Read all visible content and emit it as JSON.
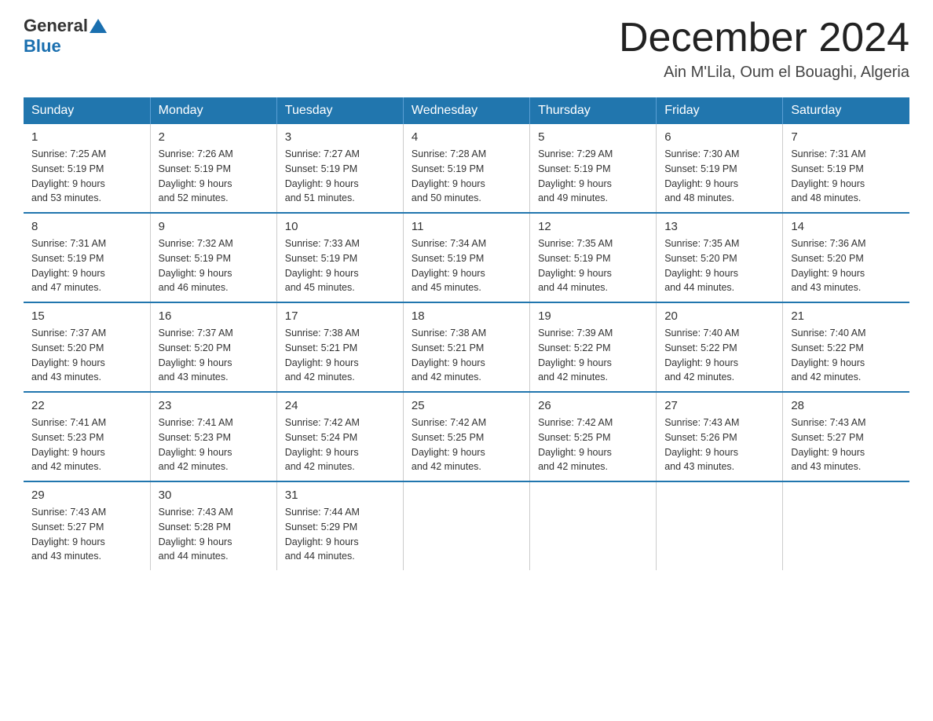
{
  "header": {
    "logo_general": "General",
    "logo_blue": "Blue",
    "month_title": "December 2024",
    "location": "Ain M'Lila, Oum el Bouaghi, Algeria"
  },
  "weekdays": [
    "Sunday",
    "Monday",
    "Tuesday",
    "Wednesday",
    "Thursday",
    "Friday",
    "Saturday"
  ],
  "weeks": [
    [
      {
        "day": "1",
        "sunrise": "7:25 AM",
        "sunset": "5:19 PM",
        "daylight": "9 hours and 53 minutes."
      },
      {
        "day": "2",
        "sunrise": "7:26 AM",
        "sunset": "5:19 PM",
        "daylight": "9 hours and 52 minutes."
      },
      {
        "day": "3",
        "sunrise": "7:27 AM",
        "sunset": "5:19 PM",
        "daylight": "9 hours and 51 minutes."
      },
      {
        "day": "4",
        "sunrise": "7:28 AM",
        "sunset": "5:19 PM",
        "daylight": "9 hours and 50 minutes."
      },
      {
        "day": "5",
        "sunrise": "7:29 AM",
        "sunset": "5:19 PM",
        "daylight": "9 hours and 49 minutes."
      },
      {
        "day": "6",
        "sunrise": "7:30 AM",
        "sunset": "5:19 PM",
        "daylight": "9 hours and 48 minutes."
      },
      {
        "day": "7",
        "sunrise": "7:31 AM",
        "sunset": "5:19 PM",
        "daylight": "9 hours and 48 minutes."
      }
    ],
    [
      {
        "day": "8",
        "sunrise": "7:31 AM",
        "sunset": "5:19 PM",
        "daylight": "9 hours and 47 minutes."
      },
      {
        "day": "9",
        "sunrise": "7:32 AM",
        "sunset": "5:19 PM",
        "daylight": "9 hours and 46 minutes."
      },
      {
        "day": "10",
        "sunrise": "7:33 AM",
        "sunset": "5:19 PM",
        "daylight": "9 hours and 45 minutes."
      },
      {
        "day": "11",
        "sunrise": "7:34 AM",
        "sunset": "5:19 PM",
        "daylight": "9 hours and 45 minutes."
      },
      {
        "day": "12",
        "sunrise": "7:35 AM",
        "sunset": "5:19 PM",
        "daylight": "9 hours and 44 minutes."
      },
      {
        "day": "13",
        "sunrise": "7:35 AM",
        "sunset": "5:20 PM",
        "daylight": "9 hours and 44 minutes."
      },
      {
        "day": "14",
        "sunrise": "7:36 AM",
        "sunset": "5:20 PM",
        "daylight": "9 hours and 43 minutes."
      }
    ],
    [
      {
        "day": "15",
        "sunrise": "7:37 AM",
        "sunset": "5:20 PM",
        "daylight": "9 hours and 43 minutes."
      },
      {
        "day": "16",
        "sunrise": "7:37 AM",
        "sunset": "5:20 PM",
        "daylight": "9 hours and 43 minutes."
      },
      {
        "day": "17",
        "sunrise": "7:38 AM",
        "sunset": "5:21 PM",
        "daylight": "9 hours and 42 minutes."
      },
      {
        "day": "18",
        "sunrise": "7:38 AM",
        "sunset": "5:21 PM",
        "daylight": "9 hours and 42 minutes."
      },
      {
        "day": "19",
        "sunrise": "7:39 AM",
        "sunset": "5:22 PM",
        "daylight": "9 hours and 42 minutes."
      },
      {
        "day": "20",
        "sunrise": "7:40 AM",
        "sunset": "5:22 PM",
        "daylight": "9 hours and 42 minutes."
      },
      {
        "day": "21",
        "sunrise": "7:40 AM",
        "sunset": "5:22 PM",
        "daylight": "9 hours and 42 minutes."
      }
    ],
    [
      {
        "day": "22",
        "sunrise": "7:41 AM",
        "sunset": "5:23 PM",
        "daylight": "9 hours and 42 minutes."
      },
      {
        "day": "23",
        "sunrise": "7:41 AM",
        "sunset": "5:23 PM",
        "daylight": "9 hours and 42 minutes."
      },
      {
        "day": "24",
        "sunrise": "7:42 AM",
        "sunset": "5:24 PM",
        "daylight": "9 hours and 42 minutes."
      },
      {
        "day": "25",
        "sunrise": "7:42 AM",
        "sunset": "5:25 PM",
        "daylight": "9 hours and 42 minutes."
      },
      {
        "day": "26",
        "sunrise": "7:42 AM",
        "sunset": "5:25 PM",
        "daylight": "9 hours and 42 minutes."
      },
      {
        "day": "27",
        "sunrise": "7:43 AM",
        "sunset": "5:26 PM",
        "daylight": "9 hours and 43 minutes."
      },
      {
        "day": "28",
        "sunrise": "7:43 AM",
        "sunset": "5:27 PM",
        "daylight": "9 hours and 43 minutes."
      }
    ],
    [
      {
        "day": "29",
        "sunrise": "7:43 AM",
        "sunset": "5:27 PM",
        "daylight": "9 hours and 43 minutes."
      },
      {
        "day": "30",
        "sunrise": "7:43 AM",
        "sunset": "5:28 PM",
        "daylight": "9 hours and 44 minutes."
      },
      {
        "day": "31",
        "sunrise": "7:44 AM",
        "sunset": "5:29 PM",
        "daylight": "9 hours and 44 minutes."
      },
      null,
      null,
      null,
      null
    ]
  ],
  "labels": {
    "sunrise": "Sunrise:",
    "sunset": "Sunset:",
    "daylight": "Daylight:"
  }
}
